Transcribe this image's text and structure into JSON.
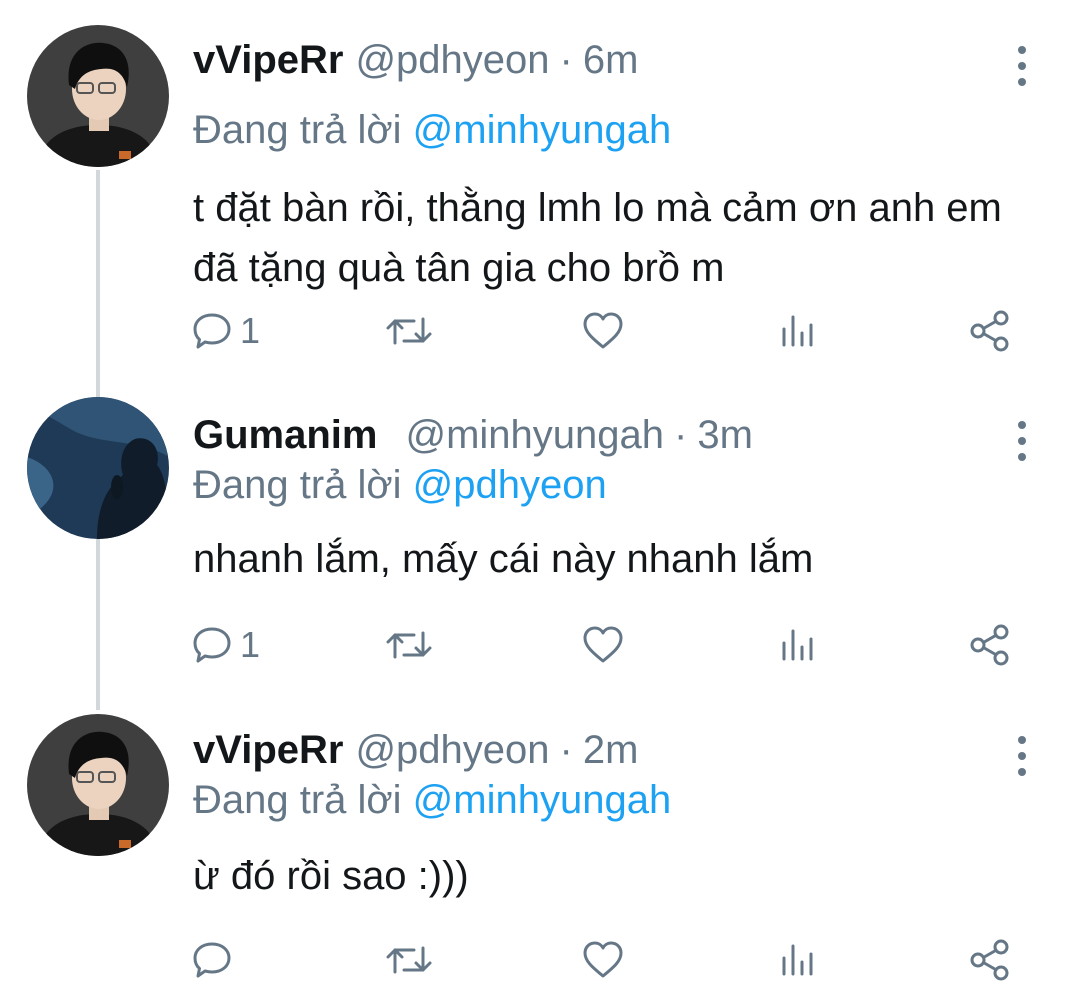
{
  "colors": {
    "text_primary": "#14171a",
    "text_secondary": "#657786",
    "link": "#1da1f2",
    "thread_line": "#d2d7db"
  },
  "tweets": [
    {
      "display_name": "vVipeRr",
      "handle": "@pdhyeon",
      "separator": "·",
      "time": "6m",
      "reply_prefix": "Đang trả lời",
      "reply_to": "@minhyungah",
      "text": "t đặt bàn rồi, thằng lmh lo mà cảm ơn anh em đã tặng quà tân gia cho brồ m",
      "reply_count": "1",
      "icons": [
        "reply-icon",
        "retweet-icon",
        "like-icon",
        "analytics-icon",
        "share-icon",
        "more-icon"
      ]
    },
    {
      "display_name": "Gumanim",
      "handle": "@minhyungah",
      "separator": "·",
      "time": "3m",
      "reply_prefix": "Đang trả lời",
      "reply_to": "@pdhyeon",
      "text": "nhanh lắm, mấy cái này nhanh lắm",
      "reply_count": "1",
      "icons": [
        "reply-icon",
        "retweet-icon",
        "like-icon",
        "analytics-icon",
        "share-icon",
        "more-icon"
      ]
    },
    {
      "display_name": "vVipeRr",
      "handle": "@pdhyeon",
      "separator": "·",
      "time": "2m",
      "reply_prefix": "Đang trả lời",
      "reply_to": "@minhyungah",
      "text": "ừ đó rồi sao :)))",
      "reply_count": "",
      "icons": [
        "reply-icon",
        "retweet-icon",
        "like-icon",
        "analytics-icon",
        "share-icon",
        "more-icon"
      ]
    }
  ]
}
